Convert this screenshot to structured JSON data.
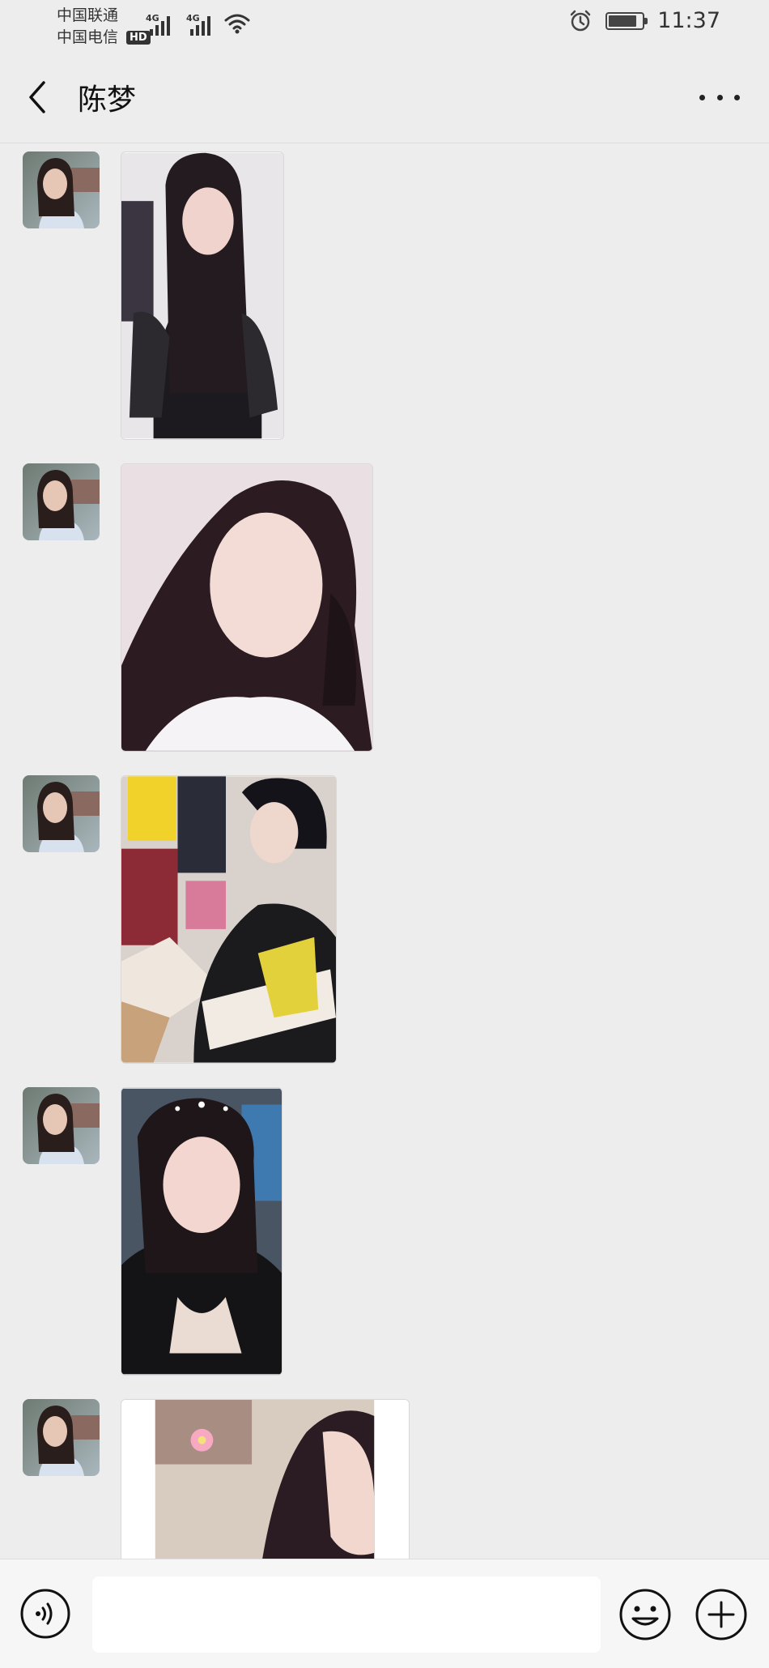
{
  "status_bar": {
    "carrier_1": "中国联通",
    "carrier_2": "中国电信",
    "hd_badge": "HD",
    "network_1": "4G",
    "network_2": "4G",
    "battery_level": 0.85,
    "time": "11:37"
  },
  "header": {
    "title": "陈梦",
    "back_icon": "chevron-left-icon",
    "more_icon": "more-dots-icon"
  },
  "messages": [
    {
      "sender": "陈梦",
      "type": "image"
    },
    {
      "sender": "陈梦",
      "type": "image"
    },
    {
      "sender": "陈梦",
      "type": "image"
    },
    {
      "sender": "陈梦",
      "type": "image"
    },
    {
      "sender": "陈梦",
      "type": "image"
    }
  ],
  "input_bar": {
    "voice_icon": "voice-icon",
    "text_value": "",
    "emoji_icon": "emoji-icon",
    "plus_icon": "plus-circle-icon"
  },
  "colors": {
    "background": "#ededed",
    "input_bar": "#f6f6f6",
    "text": "#111111"
  }
}
